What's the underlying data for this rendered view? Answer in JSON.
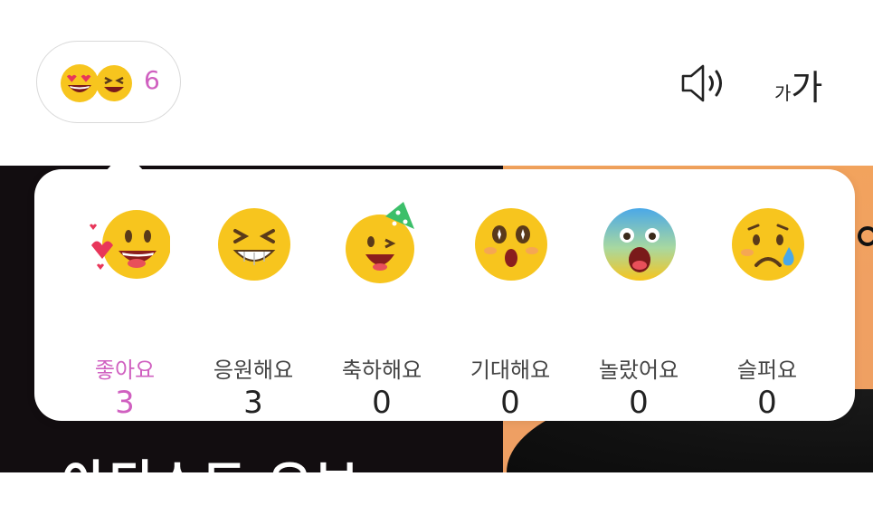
{
  "header": {
    "reaction_total": "6",
    "reaction_preview_icons": [
      "heart-eyes-icon",
      "laughing-icon"
    ],
    "speaker_icon": "speaker-icon",
    "font_size_small": "가",
    "font_size_large": "가"
  },
  "popup": {
    "reactions": [
      {
        "label": "좋아요",
        "count": "3",
        "icon": "love-emoji-icon",
        "active": true
      },
      {
        "label": "응원해요",
        "count": "3",
        "icon": "cheer-emoji-icon",
        "active": false
      },
      {
        "label": "축하해요",
        "count": "0",
        "icon": "party-emoji-icon",
        "active": false
      },
      {
        "label": "기대해요",
        "count": "0",
        "icon": "sparkle-eyes-emoji-icon",
        "active": false
      },
      {
        "label": "놀랐어요",
        "count": "0",
        "icon": "shocked-emoji-icon",
        "active": false
      },
      {
        "label": "슬퍼요",
        "count": "0",
        "icon": "sad-emoji-icon",
        "active": false
      }
    ]
  },
  "background": {
    "title": "아티스트 오브"
  },
  "colors": {
    "accent": "#d060c0",
    "emoji_yellow": "#f7c51e",
    "dark_bg": "#120d10",
    "orange_bg": "#f0a062"
  }
}
